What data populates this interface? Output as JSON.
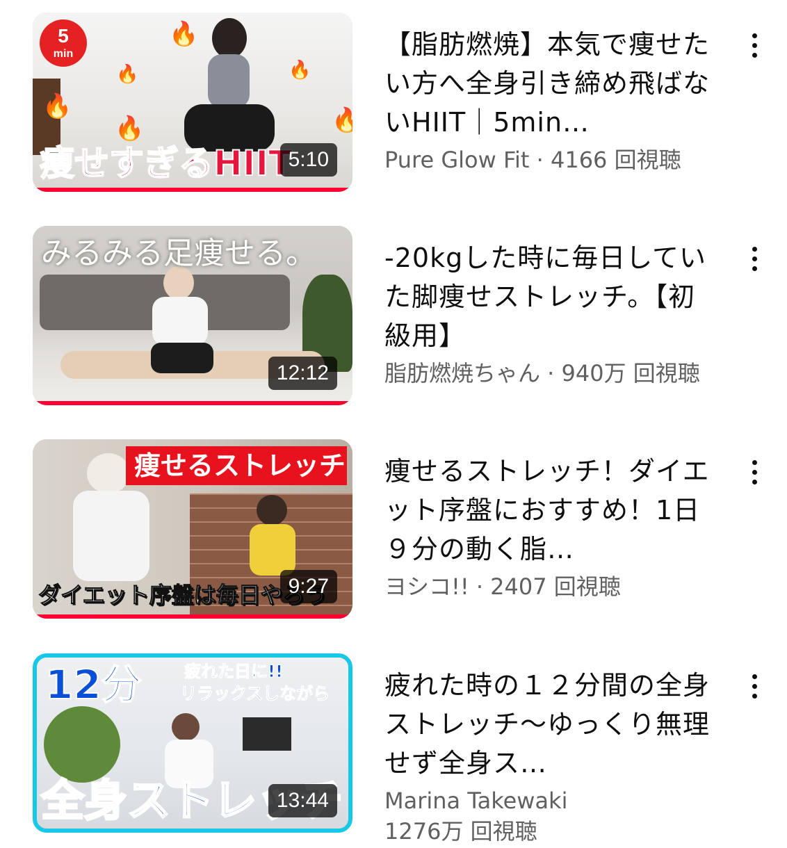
{
  "videos": [
    {
      "duration": "5:10",
      "title": "【脂肪燃焼】本気で痩せたい方へ全身引き締め飛ばないHIIT｜5min…",
      "meta_line1": "Pure Glow Fit · 4166 回視聴",
      "meta_line2": "",
      "thumbnail_text": [
        "5",
        "min",
        "痩せすぎるHIIT"
      ],
      "thumbnail_colors": {
        "bg": "#efefef",
        "text": "#e5173f",
        "badge": "#e52222"
      }
    },
    {
      "duration": "12:12",
      "title": "-20kgした時に毎日していた脚痩せストレッチ。【初級用】",
      "meta_line1": "脂肪燃焼ちゃん · 940万 回視聴",
      "meta_line2": "",
      "thumbnail_text": [
        "みるみる足痩せる。"
      ],
      "thumbnail_colors": {
        "bg": "#d9d6d1",
        "text": "#ffffff"
      }
    },
    {
      "duration": "9:27",
      "title": "痩せるストレッチ！ダイエット序盤におすすめ！1日９分の動く脂…",
      "meta_line1": "ヨシコ!! · 2407 回視聴",
      "meta_line2": "",
      "thumbnail_text": [
        "痩せるストレッチ",
        "ダイエット序盤は毎日やろう"
      ],
      "thumbnail_colors": {
        "bg": "#cfc7bd",
        "banner": "#e8121e",
        "text": "#ffffff"
      }
    },
    {
      "duration": "13:44",
      "title": "疲れた時の１２分間の全身ストレッチ〜ゆっくり無理せず全身ス…",
      "meta_line1": "Marina Takewaki",
      "meta_line2": "1276万 回視聴",
      "thumbnail_text": [
        "12分",
        "疲れた日に!!",
        "リラックスしながら",
        "全身ストレッチ"
      ],
      "thumbnail_colors": {
        "bg": "#e9ecef",
        "border": "#19c7e6",
        "text": "#0b4fd6"
      }
    }
  ],
  "icons": {
    "more": "more-vert-icon",
    "flame": "fire-icon"
  }
}
